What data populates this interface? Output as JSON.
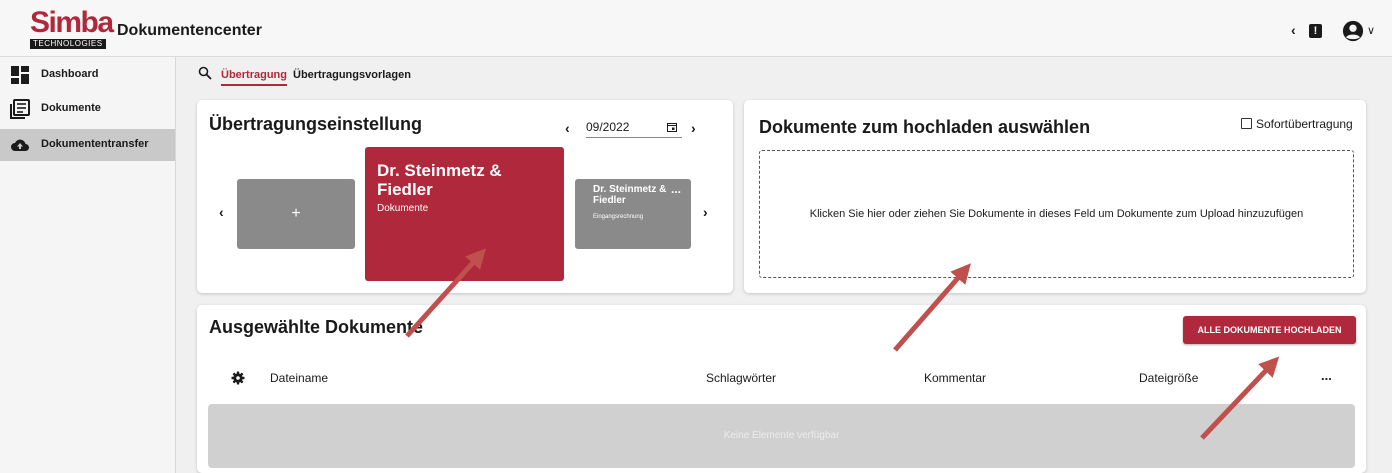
{
  "header": {
    "logo_main": "Simba",
    "logo_sub": "TECHNOLOGIES",
    "title": "Dokumentencenter",
    "back_icon": "chevron-left-icon",
    "alert_icon_glyph": "!",
    "user_icon": "account-circle-icon",
    "user_menu_icon": "chevron-down-icon"
  },
  "sidebar": {
    "items": [
      {
        "label": "Dashboard",
        "icon": "dashboard-icon",
        "active": false
      },
      {
        "label": "Dokumente",
        "icon": "documents-icon",
        "active": false
      },
      {
        "label": "Dokumententransfer",
        "icon": "cloud-upload-icon",
        "active": true
      }
    ]
  },
  "subnav": {
    "tabs": [
      {
        "label": "Übertragung",
        "active": true
      },
      {
        "label": "Übertragungsvorlagen",
        "active": false
      }
    ]
  },
  "settings_card": {
    "title": "Übertragungseinstellung",
    "month_prev": "‹",
    "month": "09/2022",
    "month_next": "›",
    "carousel_prev": "‹",
    "carousel_next": "›",
    "add_tile": "+",
    "selected_tile": {
      "title": "Dr. Steinmetz & Fiedler",
      "subtitle": "Dokumente"
    },
    "next_tile": {
      "title": "Dr. Steinmetz & Fiedler",
      "subtitle": "Eingangsrechnung",
      "more": "..."
    }
  },
  "upload_card": {
    "title": "Dokumente zum hochladen auswählen",
    "instant_label": "Sofortübertragung",
    "instant_checked": false,
    "dropzone_text": "Klicken Sie hier oder ziehen Sie Dokumente in dieses Feld um Dokumente zum Upload hinzuzufügen"
  },
  "selected_card": {
    "title": "Ausgewählte Dokumente",
    "upload_all_label": "ALLE DOKUMENTE HOCHLADEN",
    "columns": [
      "Dateiname",
      "Schlagwörter",
      "Kommentar",
      "Dateigröße"
    ],
    "more": "...",
    "empty_text": "Keine Elemente verfügbar"
  },
  "colors": {
    "brand": "#b0283c",
    "tile_gray": "#8a8a8a",
    "annotation_arrow": "#c0504d"
  }
}
